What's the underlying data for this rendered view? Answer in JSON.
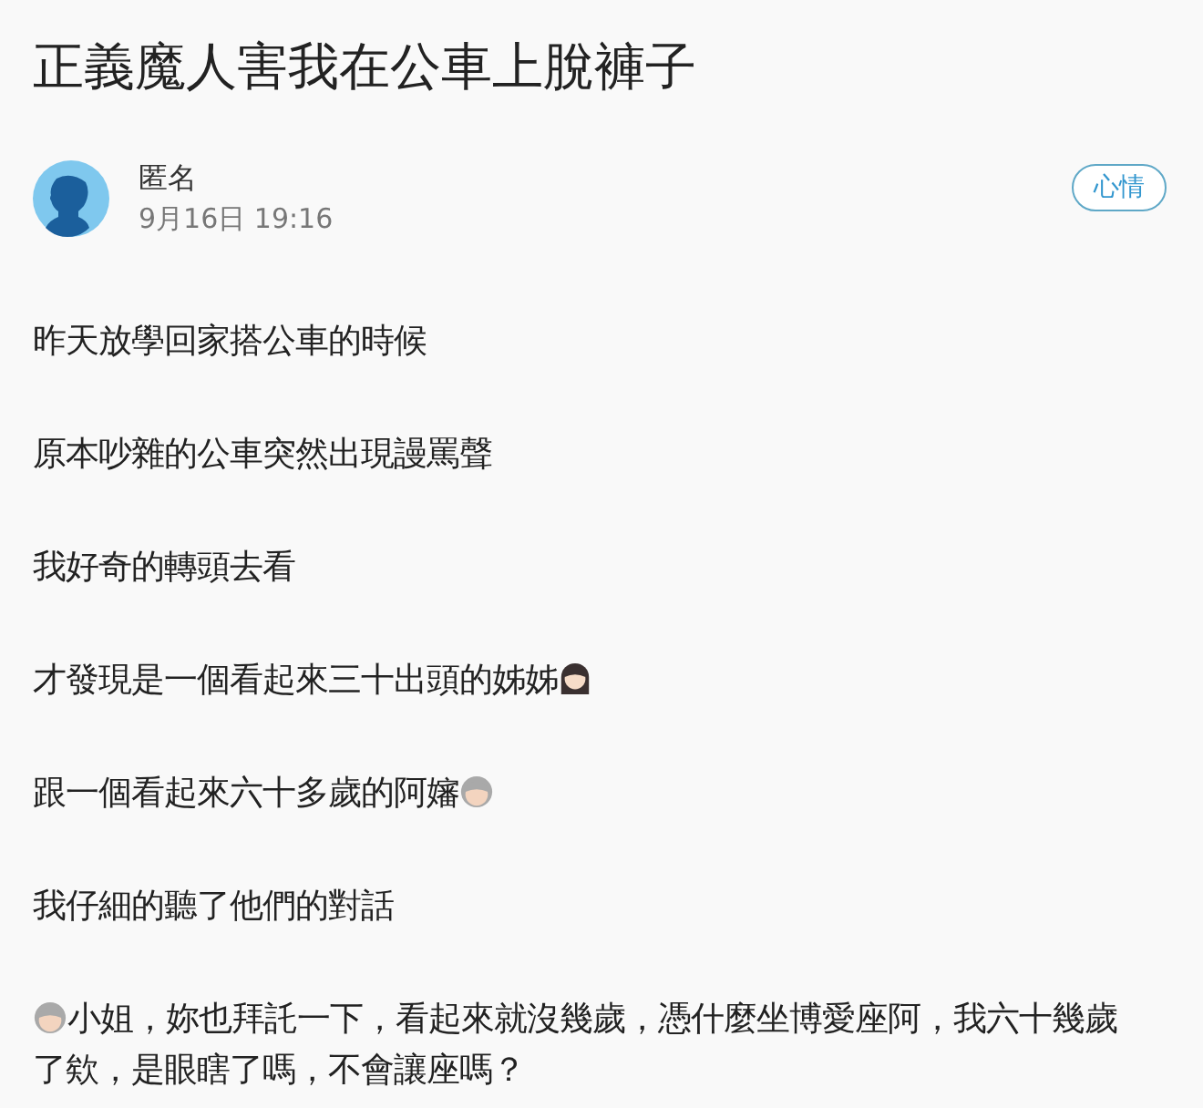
{
  "title": "正義魔人害我在公車上脫褲子",
  "author": {
    "name": "匿名",
    "time": "9月16日 19:16"
  },
  "topic_tag": "心情",
  "paragraphs": [
    {
      "kind": "plain",
      "text": "昨天放學回家搭公車的時候"
    },
    {
      "kind": "plain",
      "text": "原本吵雜的公車突然出現謾罵聲"
    },
    {
      "kind": "plain",
      "text": "我好奇的轉頭去看"
    },
    {
      "kind": "woman_after",
      "text": "才發現是一個看起來三十出頭的姊姊"
    },
    {
      "kind": "elder_after",
      "text": "跟一個看起來六十多歲的阿嬸"
    },
    {
      "kind": "plain",
      "text": "我仔細的聽了他們的對話"
    },
    {
      "kind": "elder_before",
      "text": "小姐，妳也拜託一下，看起來就沒幾歲，憑什麼坐博愛座阿，我六十幾歲了欸，是眼瞎了嗎，不會讓座嗎？"
    }
  ]
}
